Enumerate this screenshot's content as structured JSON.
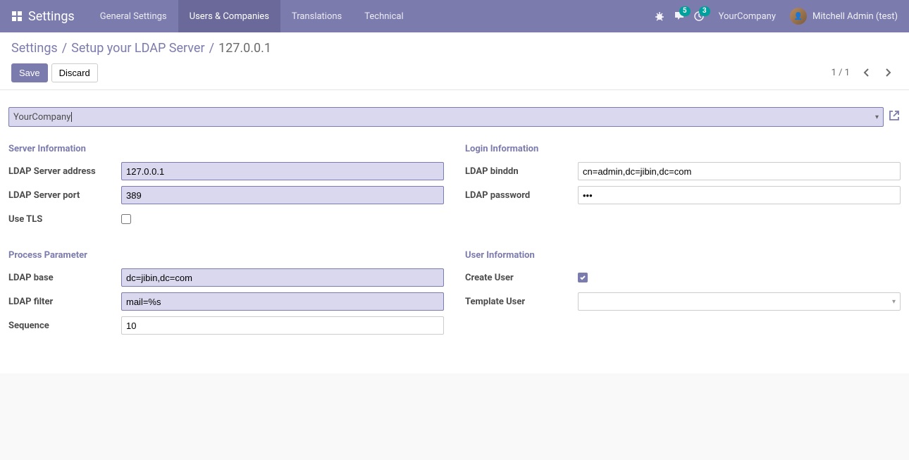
{
  "navbar": {
    "brand": "Settings",
    "menu": [
      "General Settings",
      "Users & Companies",
      "Translations",
      "Technical"
    ],
    "active_index": 1,
    "messages_badge": "5",
    "activities_badge": "3",
    "company": "YourCompany",
    "user": "Mitchell Admin (test)"
  },
  "breadcrumb": {
    "root": "Settings",
    "parent": "Setup your LDAP Server",
    "current": "127.0.0.1"
  },
  "buttons": {
    "save": "Save",
    "discard": "Discard"
  },
  "pager": {
    "text": "1 / 1"
  },
  "company_field": "YourCompany",
  "groups": {
    "server_info": {
      "title": "Server Information",
      "address_label": "LDAP Server address",
      "address": "127.0.0.1",
      "port_label": "LDAP Server port",
      "port": "389",
      "tls_label": "Use TLS",
      "tls": false
    },
    "login_info": {
      "title": "Login Information",
      "binddn_label": "LDAP binddn",
      "binddn": "cn=admin,dc=jibin,dc=com",
      "password_label": "LDAP password",
      "password": "•••"
    },
    "process": {
      "title": "Process Parameter",
      "base_label": "LDAP base",
      "base": "dc=jibin,dc=com",
      "filter_label": "LDAP filter",
      "filter": "mail=%s",
      "sequence_label": "Sequence",
      "sequence": "10"
    },
    "user_info": {
      "title": "User Information",
      "create_label": "Create User",
      "create": true,
      "template_label": "Template User",
      "template": ""
    }
  }
}
